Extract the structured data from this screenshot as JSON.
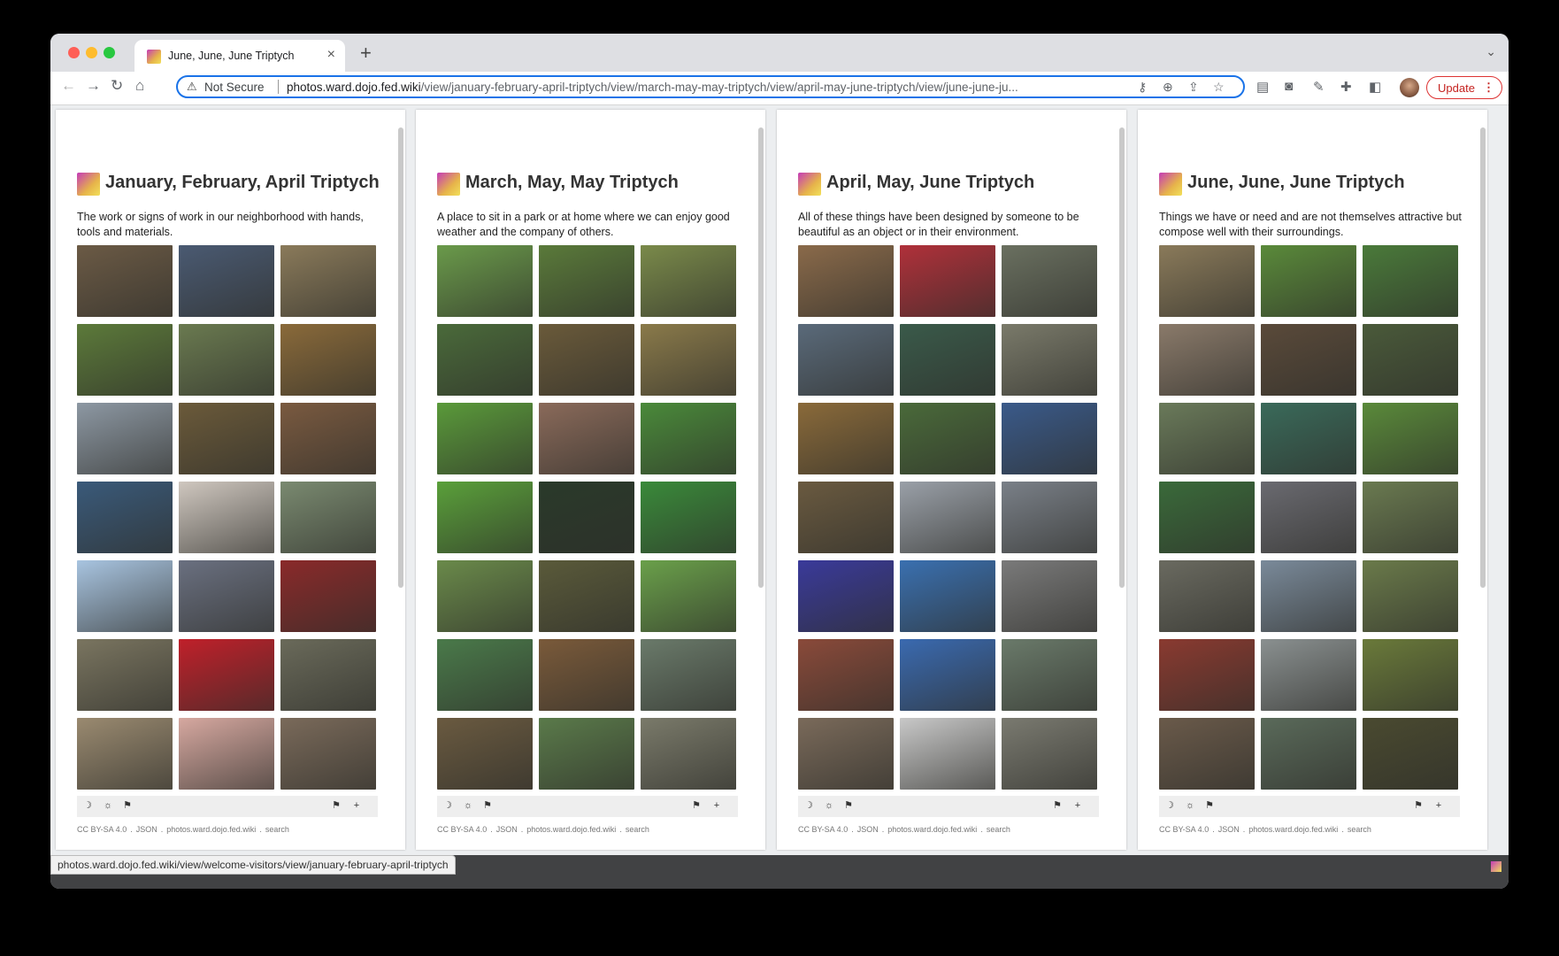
{
  "browser": {
    "tab_title": "June, June, June Triptych",
    "not_secure": "Not Secure",
    "url_host": "photos.ward.dojo.fed.wiki",
    "url_path": "/view/january-february-april-triptych/view/march-may-may-triptych/view/april-may-june-triptych/view/june-june-ju...",
    "update_label": "Update",
    "status_url": "photos.ward.dojo.fed.wiki/view/welcome-visitors/view/january-february-april-triptych"
  },
  "license": {
    "cc": "CC BY-SA 4.0",
    "json": "JSON",
    "site": "photos.ward.dojo.fed.wiki",
    "search": "search"
  },
  "pages": [
    {
      "title": "January, February, April Triptych",
      "description": "The work or signs of work in our neighborhood with hands, tools and materials.",
      "photos": [
        "#6b5a45",
        "#4a5a72",
        "#8a7a5a",
        "#5c7a3a",
        "#6a7a50",
        "#8a6a3a",
        "#8d98a3",
        "#6b5a3a",
        "#7a5a40",
        "#3a5a7a",
        "#cfc7bf",
        "#7a8a70",
        "#a8c4e0",
        "#6a7080",
        "#8a2a2a",
        "#7a7560",
        "#c0202a",
        "#6a6a5a",
        "#9a8a70",
        "#d6a8a0",
        "#7a6a5a"
      ]
    },
    {
      "title": "March, May, May Triptych",
      "description": "A place to sit in a park or at home where we can enjoy good weather and the company of others.",
      "photos": [
        "#6a9a4a",
        "#5a7a3a",
        "#7a8a4a",
        "#4a6a3a",
        "#6a5a3a",
        "#8a7a4a",
        "#5a9a3a",
        "#8a6a5a",
        "#4a8a3a",
        "#5aa03a",
        "#2a3a2a",
        "#3a8a3a",
        "#6a8a4a",
        "#5a5a3a",
        "#6aa04a",
        "#4a7a4a",
        "#7a5a3a",
        "#6a7a6a",
        "#6a5a40",
        "#5a7a4a",
        "#7a7a6a"
      ]
    },
    {
      "title": "April, May, June Triptych",
      "description": "All of these things have been designed by someone to be beautiful as an object or in their environment.",
      "photos": [
        "#8a6a4a",
        "#b0303a",
        "#6a7060",
        "#5a6a7a",
        "#3a5a4a",
        "#7a7a6a",
        "#8a6a3a",
        "#4a6a3a",
        "#3a5a8a",
        "#6a5a40",
        "#9aa0a8",
        "#7a8088",
        "#3a3a9a",
        "#3a70b0",
        "#7a7a7a",
        "#8a4a3a",
        "#3a6ab0",
        "#6a7a6a",
        "#7a6a5a",
        "#c8c8c8",
        "#7a7a70"
      ]
    },
    {
      "title": "June, June, June Triptych",
      "description": "Things we have or need and are not themselves attractive but compose well with their surroundings.",
      "photos": [
        "#8a7a5a",
        "#5a8a3a",
        "#4a7a3a",
        "#8a7a6a",
        "#5a4a3a",
        "#4a5a3a",
        "#6a7a5a",
        "#3a6a5a",
        "#5a8a3a",
        "#3a6a3a",
        "#6a6a70",
        "#6a7a50",
        "#6a6a60",
        "#7a8a9a",
        "#6a7a4a",
        "#8a3a30",
        "#8a9090",
        "#6a7a3a",
        "#6a5a4a",
        "#5a6a5a",
        "#4a4a30"
      ]
    }
  ],
  "colors": {
    "accent": "#1a73e8",
    "update": "#c5221f"
  }
}
